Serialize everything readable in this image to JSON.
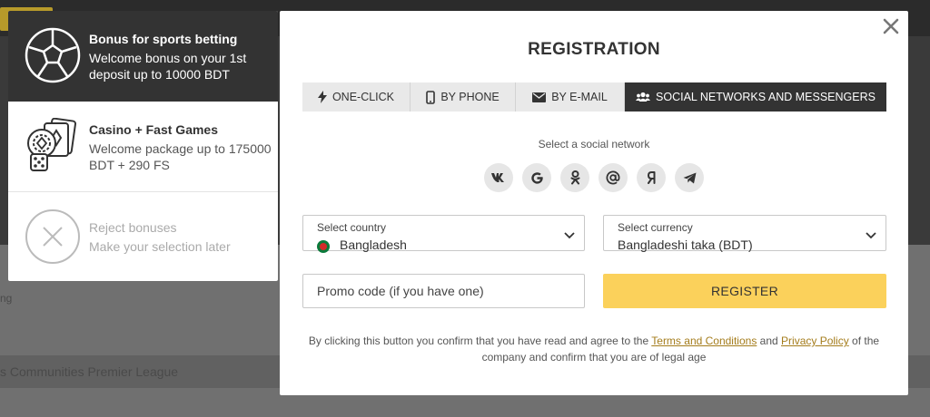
{
  "bonuses": [
    {
      "title": "Bonus for sports betting",
      "desc": "Welcome bonus on your 1st deposit up to 10000 BDT",
      "icon": "soccer-ball-icon",
      "active": true
    },
    {
      "title": "Casino + Fast Games",
      "desc": "Welcome package up to 175000 BDT + 290 FS",
      "icon": "casino-chips-icon",
      "active": false
    },
    {
      "title": "Reject bonuses",
      "desc": "Make your selection later",
      "icon": "reject-x-icon",
      "active": false
    }
  ],
  "background": {
    "league_text": "s Communities Premier League",
    "ng_text": "ng"
  },
  "modal": {
    "title": "REGISTRATION",
    "tabs": [
      {
        "label": "ONE-CLICK",
        "icon": "lightning-icon"
      },
      {
        "label": "BY PHONE",
        "icon": "phone-icon"
      },
      {
        "label": "BY E-MAIL",
        "icon": "envelope-icon"
      },
      {
        "label": "SOCIAL NETWORKS AND MESSENGERS",
        "icon": "users-icon",
        "active": true
      }
    ],
    "social_label": "Select a social network",
    "socials": [
      {
        "name": "vk",
        "glyph": "vk"
      },
      {
        "name": "google",
        "glyph": "G"
      },
      {
        "name": "odnoklassniki",
        "glyph": "ok"
      },
      {
        "name": "mail",
        "glyph": "@"
      },
      {
        "name": "yandex",
        "glyph": "Я"
      },
      {
        "name": "telegram",
        "glyph": "tg"
      }
    ],
    "country": {
      "label": "Select country",
      "value": "Bangladesh"
    },
    "currency": {
      "label": "Select currency",
      "value": "Bangladeshi taka (BDT)"
    },
    "promo_placeholder": "Promo code (if you have one)",
    "register_label": "REGISTER",
    "disclaimer": {
      "before": "By clicking this button you confirm that you have read and agree to the ",
      "terms": "Terms and Conditions",
      "and": " and ",
      "privacy": "Privacy Policy",
      "after": " of the company and confirm that you are of legal age"
    }
  },
  "colors": {
    "accent": "#fbd15b",
    "dark": "#333333",
    "link": "#a47c1b"
  }
}
